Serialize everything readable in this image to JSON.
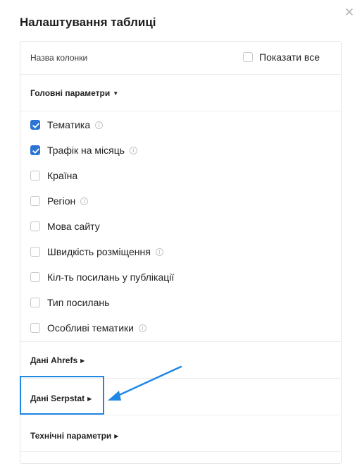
{
  "dialog": {
    "title": "Налаштування таблиці",
    "close_icon": "close-icon"
  },
  "header": {
    "column_name": "Назва колонки",
    "show_all_label": "Показати все",
    "show_all_checked": false
  },
  "sections": {
    "main": {
      "label": "Головні параметри",
      "expanded": true
    },
    "ahrefs": {
      "label": "Дані Ahrefs",
      "expanded": false
    },
    "serpstat": {
      "label": "Дані Serpstat",
      "expanded": false
    },
    "technical": {
      "label": "Технічні параметри",
      "expanded": false
    }
  },
  "items": [
    {
      "label": "Тематика",
      "checked": true,
      "info": true
    },
    {
      "label": "Трафік на місяць",
      "checked": true,
      "info": true
    },
    {
      "label": "Країна",
      "checked": false,
      "info": false
    },
    {
      "label": "Регіон",
      "checked": false,
      "info": true
    },
    {
      "label": "Мова сайту",
      "checked": false,
      "info": false
    },
    {
      "label": "Швидкість розміщення",
      "checked": false,
      "info": true
    },
    {
      "label": "Кіл-ть посилань у публікації",
      "checked": false,
      "info": false
    },
    {
      "label": "Тип посилань",
      "checked": false,
      "info": false
    },
    {
      "label": "Особливі тематики",
      "checked": false,
      "info": true
    }
  ],
  "colors": {
    "accent": "#2a74d4",
    "annotation": "#1f88e5"
  }
}
